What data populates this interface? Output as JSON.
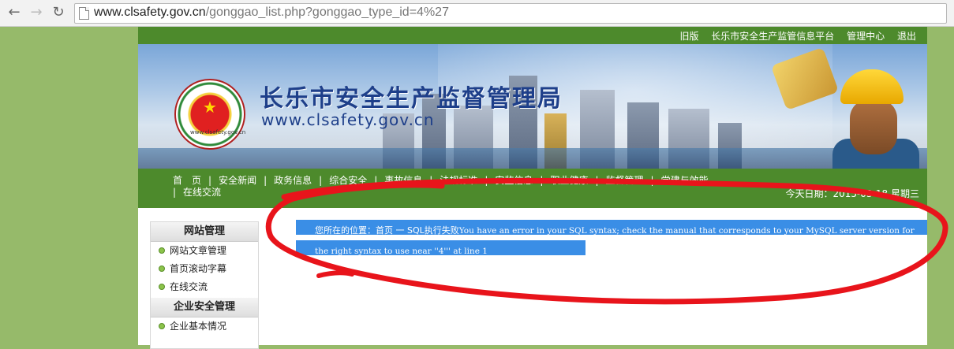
{
  "browser": {
    "back_icon": "arrow-left-icon",
    "forward_icon": "arrow-right-icon",
    "reload_icon": "reload-icon",
    "url_domain": "www.clsafety.gov.cn",
    "url_path": "/gonggao_list.php?gonggao_type_id=4%27"
  },
  "topbar": {
    "links": [
      "旧版",
      "长乐市安全生产监管信息平台",
      "管理中心",
      "退出"
    ]
  },
  "header": {
    "title": "长乐市安全生产监督管理局",
    "domain": "www.clsafety.gov.cn",
    "emblem_text": "www.clsafety.gov.cn"
  },
  "menu": {
    "items": [
      "首　页",
      "安全新闻",
      "政务信息",
      "综合安全",
      "事故信息",
      "法规标准",
      "安监信息",
      "职业健康",
      "监督管理",
      "党建与效能",
      "在线交流"
    ],
    "date": "今天日期：2015-03-18 星期三"
  },
  "sidebar": {
    "section1_title": "网站管理",
    "section1_items": [
      "网站文章管理",
      "首页滚动字幕",
      "在线交流"
    ],
    "section2_title": "企业安全管理",
    "section2_items": [
      "企业基本情况"
    ]
  },
  "main": {
    "location_prefix": "您所在的位置：首页 一 SQL执行失败",
    "error_line1": "You have an error in your SQL syntax; check the manual that corresponds to your MySQL server",
    "error_line2": "version for the right syntax to use near ''4''' at line 1"
  },
  "colors": {
    "site_green": "#4d8a2c",
    "page_bg": "#96ba6a",
    "selection_blue": "#3a8ee6",
    "annotation_red": "#e8141b"
  }
}
